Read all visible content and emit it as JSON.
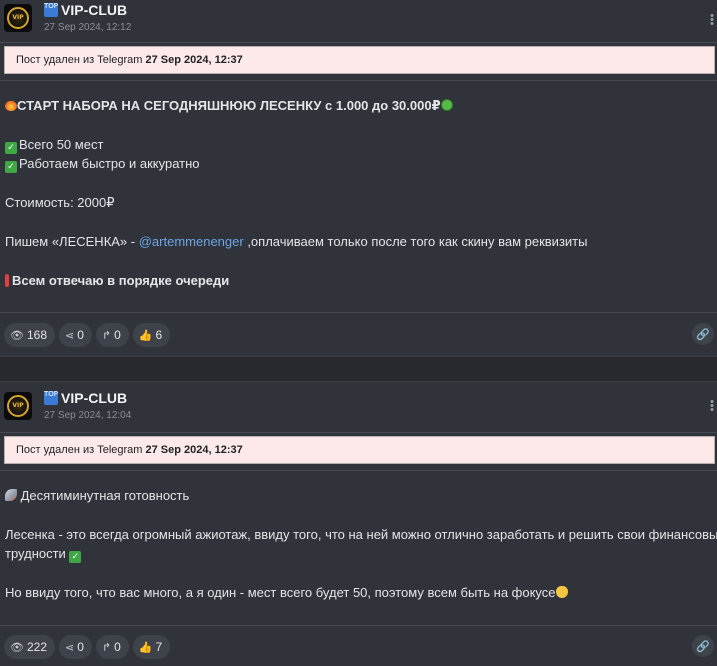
{
  "posts": [
    {
      "channel": {
        "badge": "TOP",
        "name": "VIP-CLUB",
        "avatar_text": "VIP"
      },
      "date": "27 Sep 2024, 12:12",
      "deleted_notice": {
        "text": "Пост удален из Telegram",
        "when": "27 Sep 2024, 12:37"
      },
      "lines": {
        "l1": "СТАРТ НАБОРА НА СЕГОДНЯШНЮЮ ЛЕСЕНКУ с 1.000 до 30.000₽",
        "l2": "Всего 50 мест",
        "l3": "Работаем быстро и аккуратно",
        "l4": "Стоимость: 2000₽",
        "l5a": "Пишем «ЛЕСЕНКА» - ",
        "l5link": "@artemmenenger",
        "l5b": " ,оплачиваем только после того как скину вам реквизиты",
        "l6": "Всем отвечаю в порядке очереди"
      },
      "stats": {
        "views": "168",
        "shares": "0",
        "forwards": "0",
        "likes": "6"
      },
      "icons": [
        "fire-emoji",
        "money-face-emoji",
        "check-mark-emoji",
        "exclamation-emoji",
        "eye-icon",
        "share-icon",
        "forward-icon",
        "thumbs-up-icon",
        "link-icon",
        "kebab-menu-icon"
      ]
    },
    {
      "channel": {
        "badge": "TOP",
        "name": "VIP-CLUB",
        "avatar_text": "VIP"
      },
      "date": "27 Sep 2024, 12:04",
      "deleted_notice": {
        "text": "Пост удален из Telegram",
        "when": "27 Sep 2024, 12:37"
      },
      "lines": {
        "l1": "Десятиминутная готовность",
        "l2": "Лесенка - это всегда огромный ажиотаж, ввиду того, что на ней можно отлично заработать и решить свои финансовые",
        "l3": "трудности",
        "l4": "Но ввиду того, что вас много, а я один - мест всего будет 50, поэтому всем быть на фокусе"
      },
      "stats": {
        "views": "222",
        "shares": "0",
        "forwards": "0",
        "likes": "7"
      },
      "icons": [
        "rocket-emoji",
        "check-mark-emoji",
        "cat-emoji",
        "eye-icon",
        "share-icon",
        "forward-icon",
        "thumbs-up-icon",
        "link-icon",
        "kebab-menu-icon"
      ]
    }
  ],
  "colors": {
    "background": "#30333a",
    "deleted_bg": "#fde9e9",
    "link": "#6ba5e6",
    "pill": "#3e424a",
    "badge": "#3a7bd5"
  }
}
